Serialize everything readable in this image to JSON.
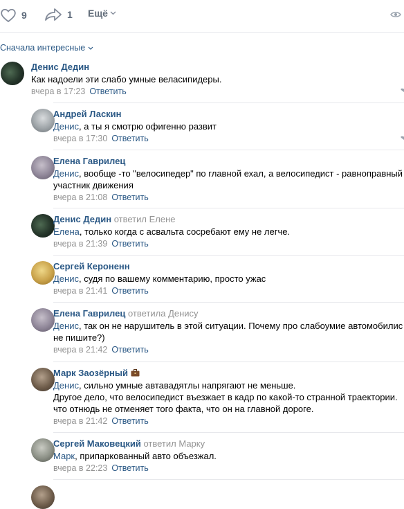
{
  "actions": {
    "likes": "9",
    "shares": "1",
    "more_label": "Ещё"
  },
  "sort_label": "Сначала интересные",
  "reply_label": "Ответить",
  "comments": [
    {
      "author": "Денис Дедин",
      "reply_to": "",
      "addressee": "",
      "text": "Как надоели эти слабо умные веласипидеры.",
      "time": "вчера в 17:23"
    },
    {
      "author": "Андрей Ласкин",
      "reply_to": "",
      "addressee": "Денис",
      "text": ", а ты я смотрю офигенно развит",
      "time": "вчера в 17:30"
    },
    {
      "author": "Елена Гаврилец",
      "reply_to": "",
      "addressee": "Денис",
      "text": ", вообще -то \"велосипедер\" по главной ехал, а велосипедист - равноправный\nучастник движения",
      "time": "вчера в 21:08"
    },
    {
      "author": "Денис Дедин",
      "reply_to": "ответил Елене",
      "addressee": "Елена",
      "text": ", только когда с асвальта сосребают ему не легче.",
      "time": "вчера в 21:39"
    },
    {
      "author": "Сергей Кероненн",
      "reply_to": "",
      "addressee": "Денис",
      "text": ", судя по вашему комментарию, просто ужас",
      "time": "вчера в 21:41"
    },
    {
      "author": "Елена Гаврилец",
      "reply_to": "ответила Денису",
      "addressee": "Денис",
      "text": ", так он не нарушитель в этой ситуации. Почему про слабоумие автомобилис\nне пишите?)",
      "time": "вчера в 21:42"
    },
    {
      "author": "Марк Заозёрный",
      "reply_to": "",
      "addressee": "Денис",
      "text": ", сильно умные автавадятлы напрягают не меньше.\nДругое дело, что велосипедист въезжает в кадр по какой-то странной траектории.\nчто отнюдь не отменяет того факта, что он на главной дороге.",
      "time": "вчера в 21:42"
    },
    {
      "author": "Сергей Маковецкий",
      "reply_to": "ответил Марку",
      "addressee": "Марк",
      "text": ", припаркованный авто объезжал.",
      "time": "вчера в 22:23"
    }
  ]
}
